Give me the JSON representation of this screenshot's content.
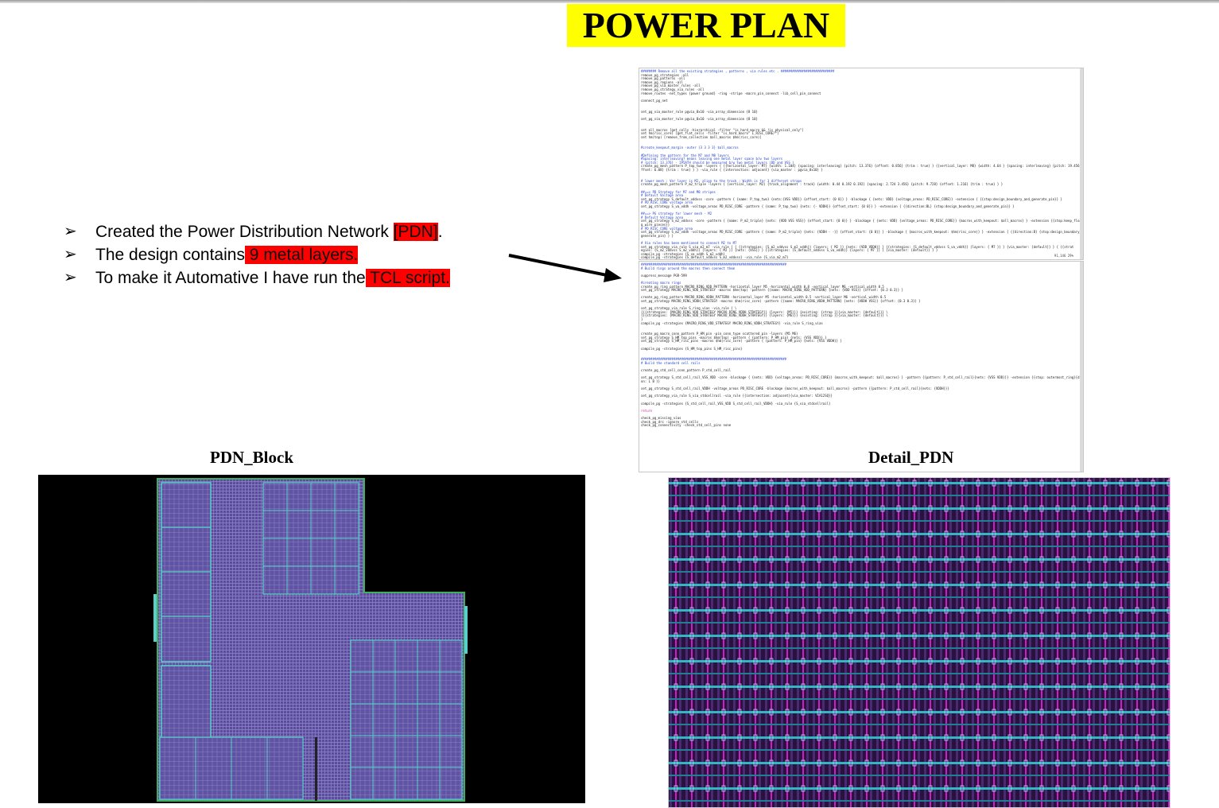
{
  "title": "POWER PLAN",
  "bullets": [
    {
      "pre": "Created the Power Distribution Network ",
      "hl": "[PDN]",
      "post": "."
    },
    {
      "pre": "The design contains",
      "hl": " 9 metal layers.",
      "post": ""
    },
    {
      "pre": "To make it Automative I have run the",
      "hl": " TCL script.",
      "post": ""
    }
  ],
  "bullet_marker": "➢",
  "captions": {
    "block": "PDN_Block",
    "detail": "Detail_PDN"
  },
  "colors": {
    "highlight": "#ff0000",
    "title_bg": "#ffff00"
  },
  "code_top": {
    "lines": [
      {
        "c": "cm",
        "t": "######## Remove all the existing strategies , patterns , via rules etc . ############################"
      },
      {
        "c": "",
        "t": "remove_pg_strategies -all"
      },
      {
        "c": "",
        "t": "remove_pg_patterns -all"
      },
      {
        "c": "",
        "t": "remove_pg_regions -all"
      },
      {
        "c": "",
        "t": "remove_pg_via_master_rules -all"
      },
      {
        "c": "",
        "t": "remove_pg_strategy_via_rules -all"
      },
      {
        "c": "",
        "t": "remove_routes -net_types {power ground} -ring -stripe -macro_pin_connect -lib_cell_pin_connect"
      },
      {
        "c": "",
        "t": ""
      },
      {
        "c": "",
        "t": "connect_pg_net"
      },
      {
        "c": "",
        "t": ""
      },
      {
        "c": "",
        "t": ""
      },
      {
        "c": "",
        "t": "set_pg_via_master_rule pgvia_8x10 -via_array_dimension {8 10}"
      },
      {
        "c": "",
        "t": ""
      },
      {
        "c": "",
        "t": "set_pg_via_master_rule pgvia_8x10 -via_array_dimension {8 10}"
      },
      {
        "c": "",
        "t": ""
      },
      {
        "c": "",
        "t": ""
      },
      {
        "c": "",
        "t": "set all_macros [get_cells -hierarchical -filter \"is_hard_macro && !is_physical_only\"]"
      },
      {
        "c": "",
        "t": "set hm(risc_core) [get_flat_cells -filter \"is_hard_macro\" I_RISC_CORE/*]"
      },
      {
        "c": "",
        "t": "set hm(top) [remove_from_collection $all_macros $hm(risc_core)]"
      },
      {
        "c": "",
        "t": ""
      },
      {
        "c": "",
        "t": ""
      },
      {
        "c": "cm",
        "t": "#create_keepout_margin -outer {3 3 3 3}  $all_macros"
      },
      {
        "c": "",
        "t": ""
      },
      {
        "c": "cm",
        "t": "#Defining the pattern for the M7 and M8 layers"
      },
      {
        "c": "cm",
        "t": "#Spacing: interleaving? means leaving one metal layer space b/w two layers"
      },
      {
        "c": "cm",
        "t": "# {pitch: 13.376} - 1P5ATH should be measured b/w two metal layers (DD and VSS )"
      },
      {
        "c": "",
        "t": "create_pg_mesh_pattern P_top_two -layers { {{horizontal_layer: M7} {width: 1.104} {spacing: interleaving} {pitch: 13.376} {offset: 0.856} {trim : true} } {{vertical_layer: M8}  {width: 4.64 } {spacing: interleaving} {pitch: 19.456} {o"
      },
      {
        "c": "",
        "t": "ffset: 6.08}  {trim : true} } } -via_rule { {intersection: adjacent} {via_master : pgvia_8x10} }"
      },
      {
        "c": "",
        "t": ""
      },
      {
        "c": "",
        "t": ""
      },
      {
        "c": "cm",
        "t": "# lower mesh : Ver layer is M2, align to the track ; Width is for 3 different straps"
      },
      {
        "c": "",
        "t": "create_pg_mesh_pattern P_m2_triple -layers { {vertical_layer: M2}  {track_alignment : track} {width: 0.44 0.192 0.192} {spacing: 2.724 3.456} {pitch: 9.728} {offset: 1.216} {trim : true} } }"
      },
      {
        "c": "",
        "t": ""
      },
      {
        "c": "cm",
        "t": "##==> PD Strategy for M7 and M8 stripes"
      },
      {
        "c": "cm",
        "t": "          # Default Voltage area"
      },
      {
        "c": "",
        "t": "set_pg_strategy S_default_vddvss -core -pattern   { {name: P_top_two} {nets:{VSS VDD}} {offset_start: {0 0}} } -blockage  { {nets: VDD} {voltage_areas: PD_RISC_CORE}} -extension { {{stop:design_boundary_and_generate_pin}} }"
      },
      {
        "c": "cm",
        "t": "          # PD_RISC_CORE voltage area"
      },
      {
        "c": "",
        "t": "set_pg_strategy S_va_vddh -voltage_areas PD_RISC_CORE -pattern   { {name: P_top_two} {nets: {- VDDH}} {offset_start: {0 0}} } -extension { {{direction:BL} {stop:design_boundary_and_generate_pin}} }"
      },
      {
        "c": "",
        "t": ""
      },
      {
        "c": "cm",
        "t": "##==> PG strategy for lower mesh - M2"
      },
      {
        "c": "cm",
        "t": "          # Default Voltage area"
      },
      {
        "c": "",
        "t": "set_pg_strategy S_m2_vddvss -core -pattern   { {name: P_m2_triple} {nets: {VDD VSS VSS}} {offset_start: {0 0}} } -blockage  { {nets: VDD} {voltage_areas: PD_RISC_CORE}} {macros_with_keepout: $all_macros} } -extension {{stop:keep_floatin"
      },
      {
        "c": "",
        "t": "g_wire_pieces}}"
      },
      {
        "c": "cm",
        "t": "          # PD_RISC_CORE voltage area"
      },
      {
        "c": "",
        "t": "set_pg_strategy S_m2_vddh -voltage_areas PD_RISC_CORE -pattern   { {name: P_m2_triple} {nets: {VDDH - -}} {offset_start: {0 0}} } -blockage  { {macros_with_keepout: $hm(risc_core)} } -extension { {{direction:B} {stop:design_boundary_and_"
      },
      {
        "c": "",
        "t": "generate_pin} } }"
      },
      {
        "c": "",
        "t": ""
      },
      {
        "c": "cm",
        "t": "# Via rules has been mentioned to connect M2 to M7"
      },
      {
        "c": "",
        "t": "set_pg_strategy_via_rule S_via_m2_m7 -via_rule { {  {{strategies: {S_m2_vddvss S_m2_vddh}}       {layers: { M2 }} {nets: {VDD VDDH}} }       {{strategies: {S_default_vddvss S_va_vddh}} {layers: { M7 }} }  {via_master: {default}} } {  {{strat"
      },
      {
        "c": "",
        "t": "egies: {S_m2_vddvss S_m2_vddh}}       {layers: { M2 }} {nets: {VSS}} }   {{strategies: {S_default_vddvss S_va_vddh}} {layers: { M7 }} } {via_master: {default}} } }"
      },
      {
        "c": "",
        "t": "compile_pg -strategies {S_va_vddh S_m2_vddh}"
      },
      {
        "c": "",
        "t": "compile_pg -strategies {S_default_vddvss S_m2_vddvss} -via_rule {S_via_m2_m7}"
      }
    ],
    "status": "91,146        29%"
  },
  "code_bottom": {
    "lines": [
      {
        "c": "cm",
        "t": "############################################################################"
      },
      {
        "c": "cm",
        "t": "# Build rings around the macros then connect them"
      },
      {
        "c": "",
        "t": ""
      },
      {
        "c": "",
        "t": "suppress_message PGR-599"
      },
      {
        "c": "",
        "t": ""
      },
      {
        "c": "cm",
        "t": "#creating macro rings"
      },
      {
        "c": "",
        "t": "create_pg_ring_pattern MACRO_RING_VDD_PATTERN -horizontal_layer M5 -horizontal_width 0.8 -vertical_layer M6 -vertical_width 0.5"
      },
      {
        "c": "",
        "t": "set_pg_strategy MACRO_RING_VDD_STRATEGY -macros $hm(top)  -pattern {{name: MACRO_RING_VDD_PATTERN} {nets: {VDD VSS}} {offset: {0.3 0.3}} }"
      },
      {
        "c": "",
        "t": ""
      },
      {
        "c": "",
        "t": "create_pg_ring_pattern MACRO_RING_VDDH_PATTERN -horizontal_layer M5 -horizontal_width 0.5 -vertical_layer M6 -vertical_width 0.5"
      },
      {
        "c": "",
        "t": "set_pg_strategy MACRO_RING_VDDH_STRATEGY -macros $hm(risc_core) -pattern {{name: MACRO_RING_VDDH_PATTERN} {nets: {VDDH VSS}} {offset: {0.3 0.3}} }"
      },
      {
        "c": "",
        "t": ""
      },
      {
        "c": "",
        "t": "set_pg_strategy_via_rule S_ring_vias -via_rule { \\"
      },
      {
        "c": "",
        "t": "        {{{strategies: {MACRO_RING_VDD_STRATEGY MACRO_RING_VDDH_STRATEGY}} {layers: {M5}}} {existing: {strap }}{via_master: {default}}} \\"
      },
      {
        "c": "",
        "t": "        {{{strategies: {MACRO_RING_VDD_STRATEGY MACRO_RING_VDDH_STRATEGY}} {layers: {M6}}} {existing: {strap }}{via_master: {default}}} \\"
      },
      {
        "c": "",
        "t": "}"
      },
      {
        "c": "",
        "t": "compile_pg -strategies {MACRO_RING_VDD_STRATEGY MACRO_RING_VDDH_STRATEGY} -via_rule S_ring_vias"
      },
      {
        "c": "",
        "t": ""
      },
      {
        "c": "",
        "t": ""
      },
      {
        "c": "",
        "t": "create_pg_macro_conn_pattern P_HM_pin -pin_conn_type scattered_pin -layers {M5 M6}"
      },
      {
        "c": "",
        "t": "set_pg_strategy S_HM_top_pins -macros $hm(top) -pattern { {pattern: P_HM_pin} {nets: {VSS VDD}} }"
      },
      {
        "c": "",
        "t": "set_pg_strategy S_HM_risc_pins -macros $hm(risc_core) -pattern { {pattern: P_HM_pin} {nets: {VSS VDDH}} }"
      },
      {
        "c": "",
        "t": ""
      },
      {
        "c": "",
        "t": "compile_pg -strategies {S_HM_top_pins S_HM_risc_pins}"
      },
      {
        "c": "",
        "t": ""
      },
      {
        "c": "",
        "t": ""
      },
      {
        "c": "cm",
        "t": "############################################################################"
      },
      {
        "c": "cm",
        "t": "# Build the standard cell rails"
      },
      {
        "c": "",
        "t": ""
      },
      {
        "c": "",
        "t": "create_pg_std_cell_conn_pattern P_std_cell_rail"
      },
      {
        "c": "",
        "t": ""
      },
      {
        "c": "",
        "t": "set_pg_strategy S_std_cell_rail_VSS_VDD -core -blockage  { {nets: VDD} {voltage_areas: PD_RISC_CORE}} {macros_with_keepout: $all_macros} } -pattern {{pattern: P_std_cell_rail}{nets: {VSS VDD}}} -extension {{stop: outermost_ring}{directi"
      },
      {
        "c": "",
        "t": "on: L B  }}"
      },
      {
        "c": "",
        "t": ""
      },
      {
        "c": "",
        "t": "set_pg_strategy S_std_cell_rail_VDDH -voltage_areas PD_RISC_CORE -blockage {macros_with_keepout: $all_macros} -pattern {{pattern: P_std_cell_rail}{nets: {VDDH}}}"
      },
      {
        "c": "",
        "t": ""
      },
      {
        "c": "",
        "t": "set_pg_strategy_via_rule S_via_stdcellrail -via_rule {{intersection: adjacent}{via_master: VIA12SQ}}"
      },
      {
        "c": "",
        "t": ""
      },
      {
        "c": "",
        "t": "compile_pg -strategies {S_std_cell_rail_VSS_VDD S_std_cell_rail_VDDH} -via_rule {S_via_stdcellrail}"
      },
      {
        "c": "",
        "t": ""
      },
      {
        "c": "pk",
        "t": "return"
      },
      {
        "c": "",
        "t": ""
      },
      {
        "c": "",
        "t": "check_pg_missing_vias"
      },
      {
        "c": "",
        "t": "check_pg_drc -ignore_std_cells"
      },
      {
        "c": "",
        "t": "check_pg_connectivity -check_std_cell_pins none"
      }
    ]
  }
}
